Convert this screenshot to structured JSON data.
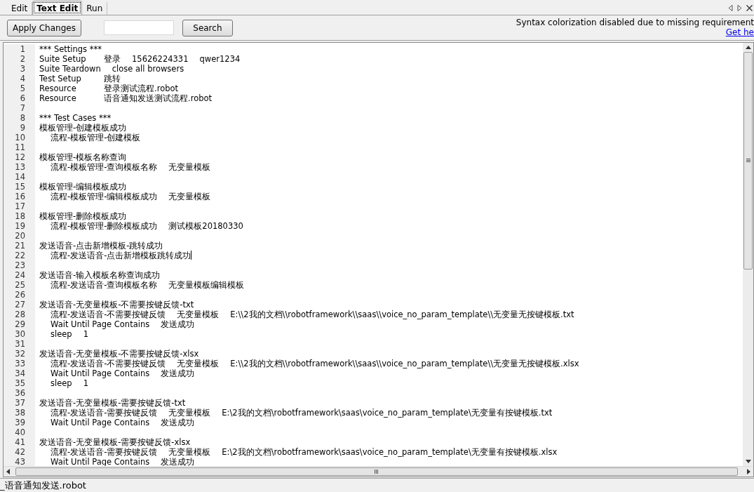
{
  "tabs": [
    {
      "label": "Edit",
      "selected": false
    },
    {
      "label": "Text Edit",
      "selected": true
    },
    {
      "label": "Run",
      "selected": false
    }
  ],
  "toolbar": {
    "apply_button": "Apply Changes",
    "search_button": "Search",
    "notice": "Syntax colorization disabled due to missing requirement",
    "help_link": "Get he"
  },
  "editor": {
    "lines": [
      {
        "number": "1",
        "indented": false,
        "cells": [
          "*** Settings ***"
        ]
      },
      {
        "number": "2",
        "indented": false,
        "cells": [
          "Suite Setup",
          "登录",
          "15626224331",
          "qwer1234"
        ]
      },
      {
        "number": "3",
        "indented": false,
        "cells": [
          "Suite Teardown",
          "close all browsers"
        ]
      },
      {
        "number": "4",
        "indented": false,
        "cells": [
          "Test Setup",
          "跳转"
        ]
      },
      {
        "number": "5",
        "indented": false,
        "cells": [
          "Resource",
          "登录测试流程.robot"
        ]
      },
      {
        "number": "6",
        "indented": false,
        "cells": [
          "Resource",
          "语音通知发送测试流程.robot"
        ]
      },
      {
        "number": "7"
      },
      {
        "number": "8",
        "indented": false,
        "cells": [
          "*** Test Cases ***"
        ]
      },
      {
        "number": "9",
        "indented": false,
        "cells": [
          "模板管理-创建模板成功"
        ]
      },
      {
        "number": "10",
        "indented": true,
        "cells": [
          "流程-模板管理-创建模板"
        ]
      },
      {
        "number": "11"
      },
      {
        "number": "12",
        "indented": false,
        "cells": [
          "模板管理-模板名称查询"
        ]
      },
      {
        "number": "13",
        "indented": true,
        "cells": [
          "流程-模板管理-查询模板名称",
          "无变量模板"
        ]
      },
      {
        "number": "14"
      },
      {
        "number": "15",
        "indented": false,
        "cells": [
          "模板管理-编辑模板成功"
        ]
      },
      {
        "number": "16",
        "indented": true,
        "cells": [
          "流程-模板管理-编辑模板成功",
          "无变量模板"
        ]
      },
      {
        "number": "17"
      },
      {
        "number": "18",
        "indented": false,
        "cells": [
          "模板管理-删除模板成功"
        ]
      },
      {
        "number": "19",
        "indented": true,
        "cells": [
          "流程-模板管理-删除模板成功",
          "测试模板20180330"
        ]
      },
      {
        "number": "20"
      },
      {
        "number": "21",
        "indented": false,
        "cells": [
          "发送语音-点击新增模板-跳转成功"
        ]
      },
      {
        "number": "22",
        "indented": true,
        "caret": true,
        "cells": [
          "流程-发送语音-点击新增模板跳转成功"
        ]
      },
      {
        "number": "23"
      },
      {
        "number": "24",
        "indented": false,
        "cells": [
          "发送语音-输入模板名称查询成功"
        ]
      },
      {
        "number": "25",
        "indented": true,
        "cells": [
          "流程-发送语音-查询模板名称",
          "无变量模板编辑模板"
        ]
      },
      {
        "number": "26"
      },
      {
        "number": "27",
        "indented": false,
        "cells": [
          "发送语音-无变量模板-不需要按键反馈-txt"
        ]
      },
      {
        "number": "28",
        "indented": true,
        "cells": [
          "流程-发送语音-不需要按键反馈",
          "无变量模板",
          "E:\\\\2我的文档\\\\robotframework\\\\saas\\\\voice_no_param_template\\\\无变量无按键模板.txt"
        ]
      },
      {
        "number": "29",
        "indented": true,
        "cells": [
          "Wait Until Page Contains",
          "发送成功"
        ]
      },
      {
        "number": "30",
        "indented": true,
        "cells": [
          "sleep",
          "1"
        ]
      },
      {
        "number": "31"
      },
      {
        "number": "32",
        "indented": false,
        "cells": [
          "发送语音-无变量模板-不需要按键反馈-xlsx"
        ]
      },
      {
        "number": "33",
        "indented": true,
        "cells": [
          "流程-发送语音-不需要按键反馈",
          "无变量模板",
          "E:\\\\2我的文档\\\\robotframework\\\\saas\\\\voice_no_param_template\\\\无变量无按键模板.xlsx"
        ]
      },
      {
        "number": "34",
        "indented": true,
        "cells": [
          "Wait Until Page Contains",
          "发送成功"
        ]
      },
      {
        "number": "35",
        "indented": true,
        "cells": [
          "sleep",
          "1"
        ]
      },
      {
        "number": "36"
      },
      {
        "number": "37",
        "indented": false,
        "cells": [
          "发送语音-无变量模板-需要按键反馈-txt"
        ]
      },
      {
        "number": "38",
        "indented": true,
        "cells": [
          "流程-发送语音-需要按键反馈",
          "无变量模板",
          "E:\\2我的文档\\robotframework\\saas\\voice_no_param_template\\无变量有按键模板.txt"
        ]
      },
      {
        "number": "39",
        "indented": true,
        "cells": [
          "Wait Until Page Contains",
          "发送成功"
        ]
      },
      {
        "number": "40"
      },
      {
        "number": "41",
        "indented": false,
        "cells": [
          "发送语音-无变量模板-需要按键反馈-xlsx"
        ]
      },
      {
        "number": "42",
        "indented": true,
        "cells": [
          "流程-发送语音-需要按键反馈",
          "无变量模板",
          "E:\\2我的文档\\robotframework\\saas\\voice_no_param_template\\无变量有按键模板.xlsx"
        ]
      },
      {
        "number": "43",
        "indented": true,
        "cells": [
          "Wait Until Page Contains",
          "发送成功"
        ]
      }
    ]
  },
  "status_bar": "_语音通知发送.robot"
}
